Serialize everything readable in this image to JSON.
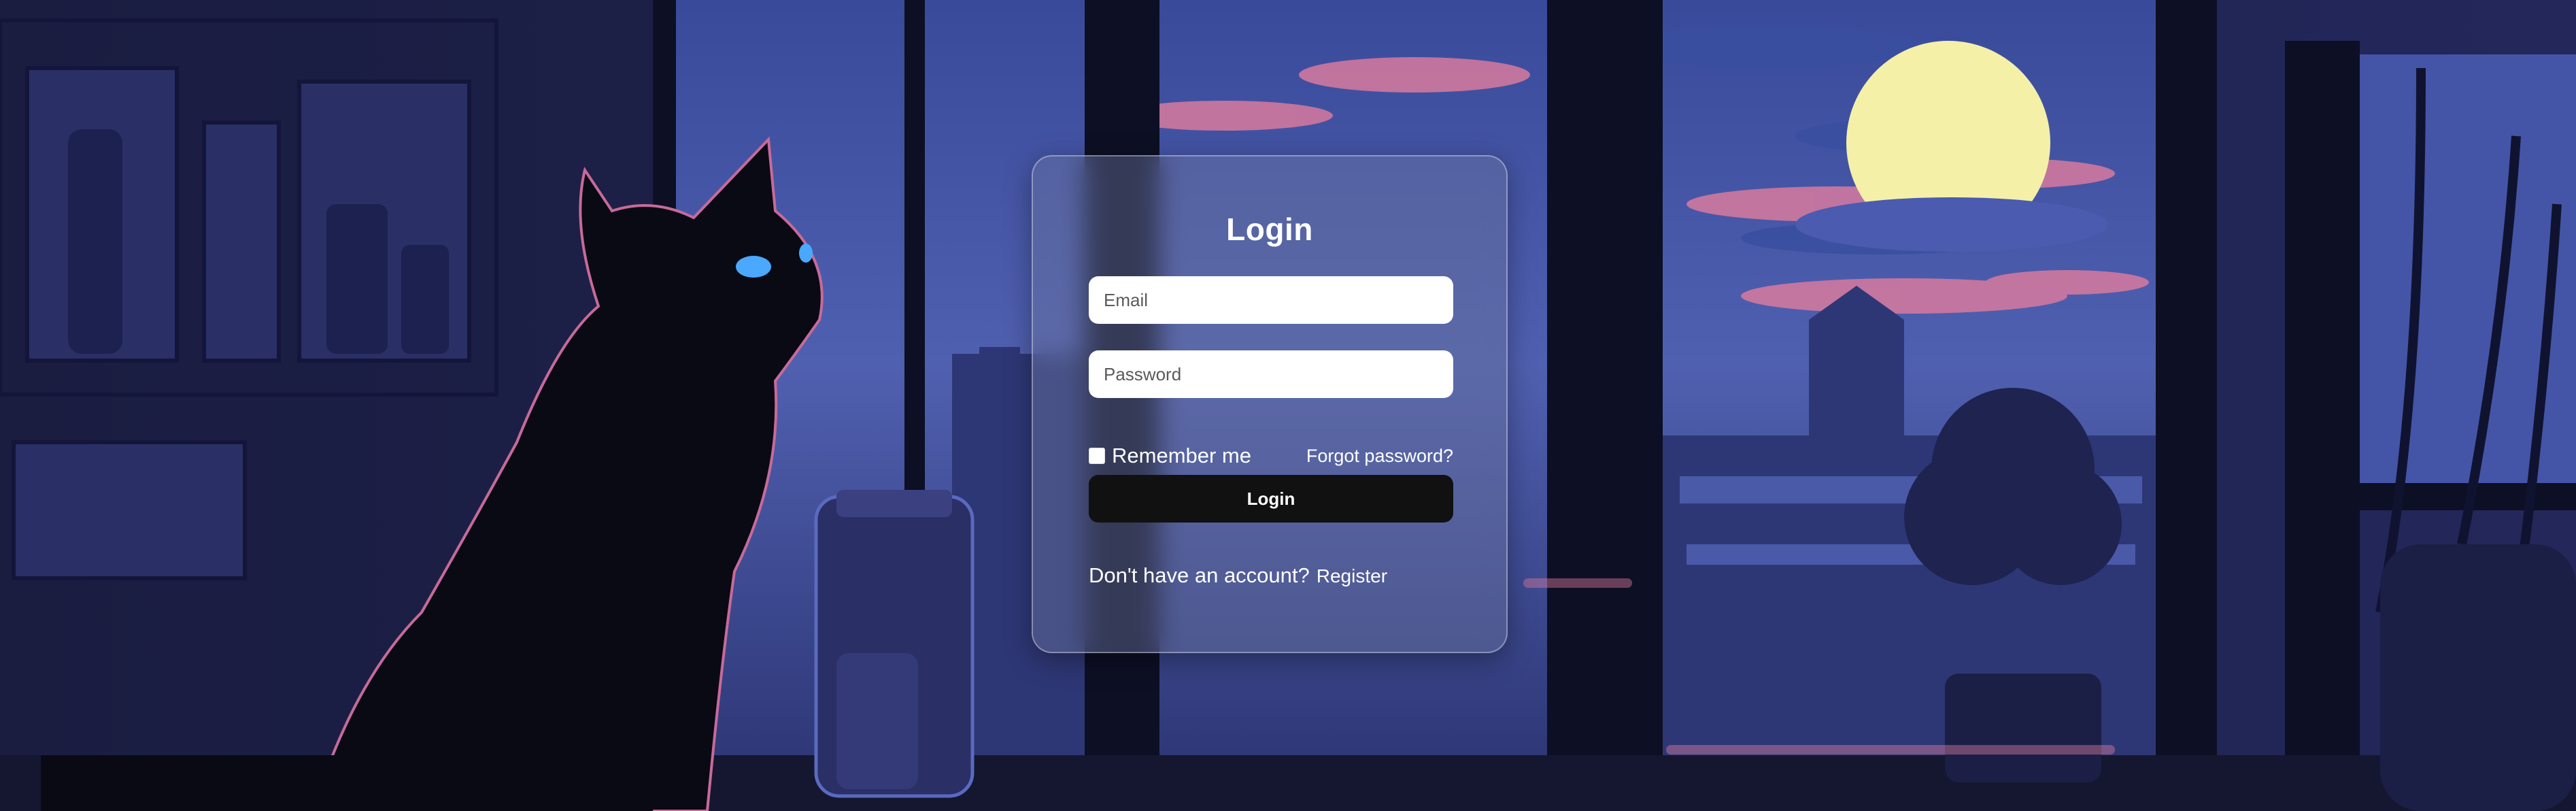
{
  "login": {
    "title": "Login",
    "email": {
      "placeholder": "Email",
      "value": ""
    },
    "password": {
      "placeholder": "Password",
      "value": ""
    },
    "remember_label": "Remember me",
    "remember_checked": false,
    "forgot_label": "Forgot password?",
    "submit_label": "Login",
    "no_account_text": "Don't have an account?",
    "register_label": "Register"
  },
  "background": {
    "description_icons": [
      "cat-silhouette-icon",
      "moon-icon",
      "window-icon",
      "plant-icon",
      "jar-icon",
      "shelf-icon"
    ]
  }
}
